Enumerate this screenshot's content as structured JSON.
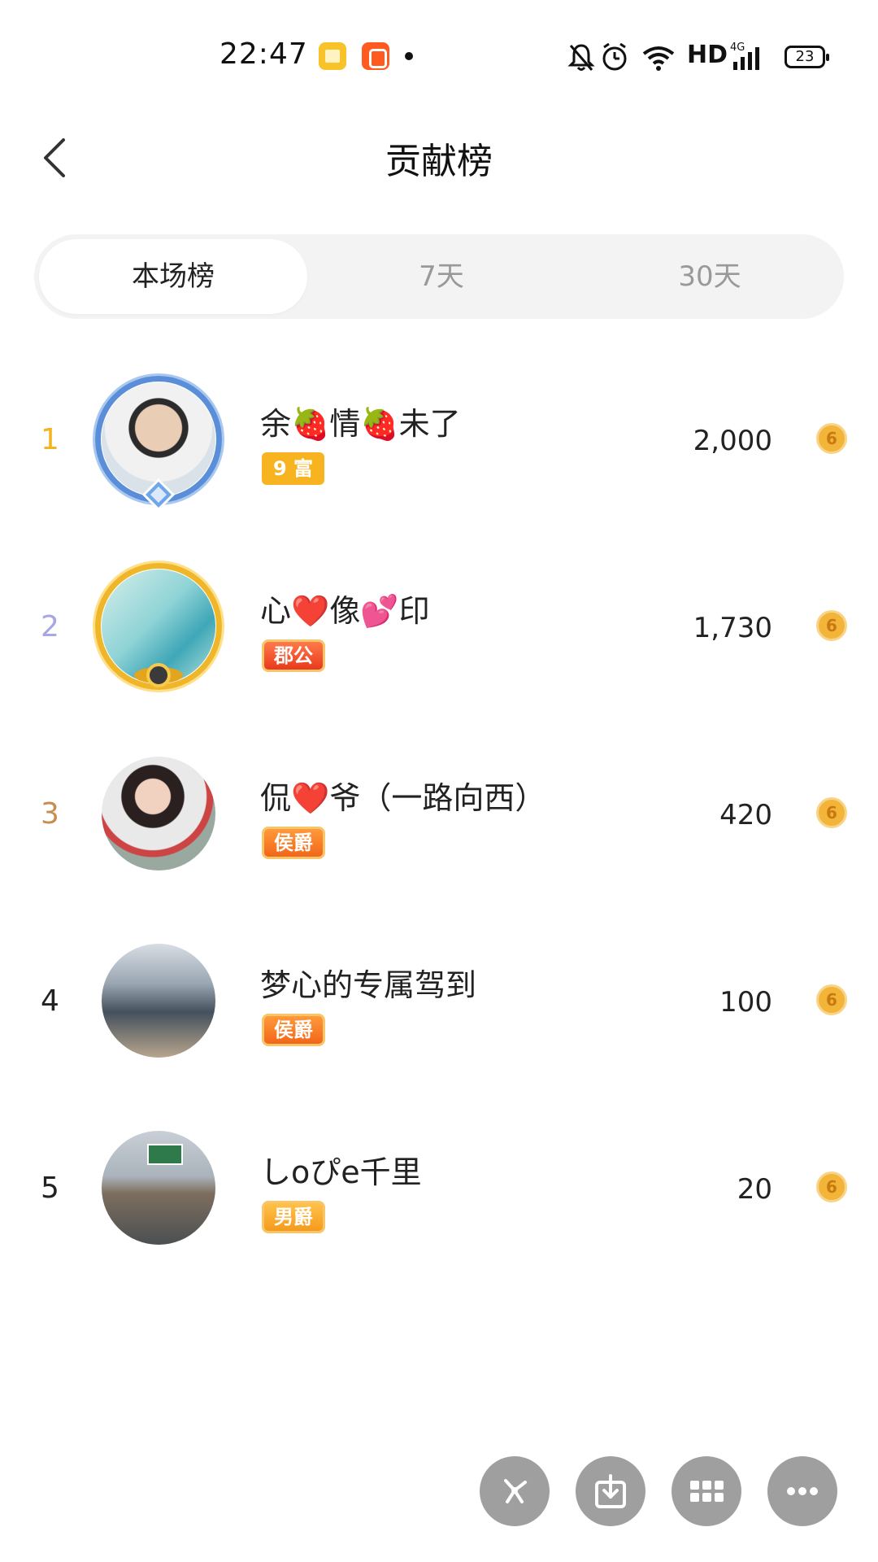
{
  "status_bar": {
    "time": "22:47",
    "network": "HD",
    "signal": "4G",
    "battery": "23"
  },
  "header": {
    "title": "贡献榜"
  },
  "tabs": [
    {
      "label": "本场榜",
      "active": true
    },
    {
      "label": "7天",
      "active": false
    },
    {
      "label": "30天",
      "active": false
    }
  ],
  "rows": [
    {
      "rank": "1",
      "name": "余🍓情🍓未了",
      "badge": "9 富",
      "score": "2,000",
      "rank_color": "#f4b321"
    },
    {
      "rank": "2",
      "name": "心❤️像💕印",
      "badge": "郡公",
      "score": "1,730",
      "rank_color": "#a7a6e6"
    },
    {
      "rank": "3",
      "name": "侃❤️爷（一路向西）",
      "badge": "侯爵",
      "score": "420",
      "rank_color": "#c98c4e"
    },
    {
      "rank": "4",
      "name": "梦心的专属驾到",
      "badge": "侯爵",
      "score": "100",
      "rank_color": "#222222"
    },
    {
      "rank": "5",
      "name": "しoぴe千里",
      "badge": "男爵",
      "score": "20",
      "rank_color": "#222222"
    }
  ],
  "colors": {
    "accent_gold": "#f4b321",
    "tab_bg": "#f3f3f3"
  },
  "icons": [
    "back-arrow-icon",
    "coin-icon",
    "share-icon",
    "download-icon",
    "grid-icon",
    "more-icon"
  ]
}
